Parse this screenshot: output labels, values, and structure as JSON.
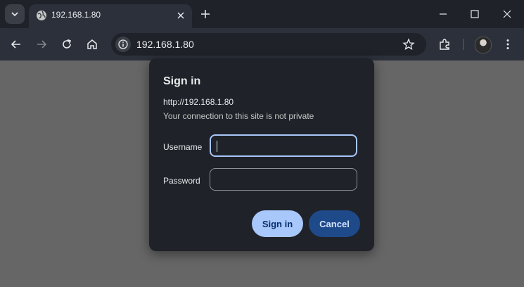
{
  "browser": {
    "tab": {
      "title": "192.168.1.80"
    },
    "omnibox": {
      "url": "192.168.1.80"
    }
  },
  "dialog": {
    "title": "Sign in",
    "origin": "http://192.168.1.80",
    "warning": "Your connection to this site is not private",
    "username_label": "Username",
    "password_label": "Password",
    "username_value": "",
    "password_value": "",
    "signin_label": "Sign in",
    "cancel_label": "Cancel"
  },
  "colors": {
    "accent": "#a8c7fa",
    "cancel_bg": "#1f4a8a",
    "backdrop": "#666666",
    "dialog_bg": "#1f2228"
  }
}
